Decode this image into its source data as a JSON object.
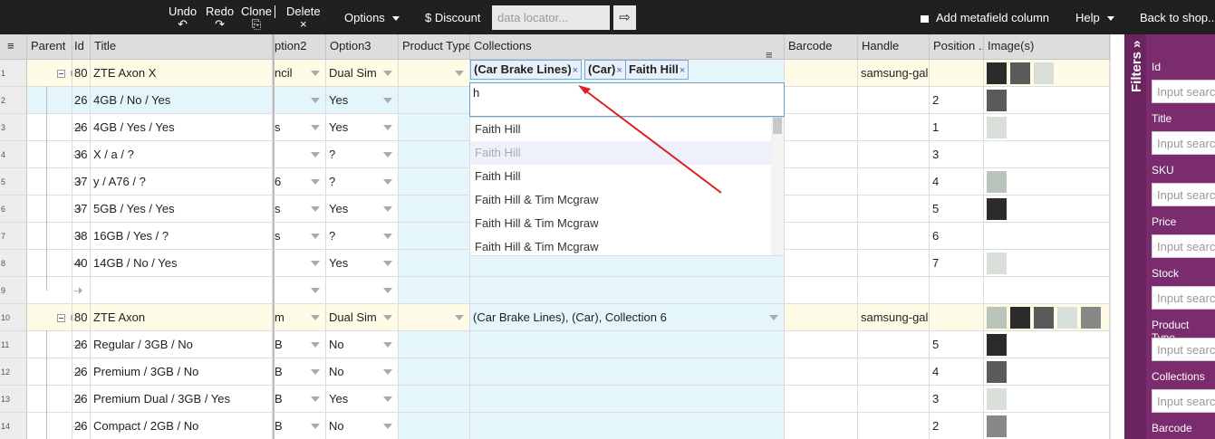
{
  "toolbar": {
    "undo": "Undo",
    "redo": "Redo",
    "clone": "Clone",
    "delete": "Delete",
    "options": "Options",
    "discount": "$ Discount",
    "locator_placeholder": "data locator...",
    "go_glyph": "⇨",
    "metafield": "Add metafield column",
    "help": "Help",
    "back": "Back to shop..."
  },
  "columns": [
    "Parent",
    "Id",
    "Title",
    "ption2",
    "Option3",
    "Product Type",
    "Collections",
    "Barcode",
    "Handle",
    "Position ...",
    "Image(s)"
  ],
  "column_menu_glyph": "≡",
  "rows": [
    {
      "n": "1",
      "id": "80",
      "title": "ZTE Axon X",
      "opt2": "ncil",
      "opt3": "Dual Sim",
      "collections": "",
      "handle": "samsung-gal",
      "position": "",
      "images": 3,
      "kind": "parent"
    },
    {
      "n": "2",
      "id": "26",
      "title": "4GB / No / Yes",
      "opt2": "",
      "opt3": "Yes",
      "collections": "",
      "handle": "",
      "position": "2",
      "images": 1,
      "kind": "child"
    },
    {
      "n": "3",
      "id": "26",
      "title": "4GB / Yes / Yes",
      "opt2": "s",
      "opt3": "Yes",
      "collections": "",
      "handle": "",
      "position": "1",
      "images": 1,
      "kind": "child"
    },
    {
      "n": "4",
      "id": "36",
      "title": "X / a / ?",
      "opt2": "",
      "opt3": "?",
      "collections": "",
      "handle": "",
      "position": "3",
      "images": 0,
      "kind": "child"
    },
    {
      "n": "5",
      "id": "37",
      "title": "y / A76 / ?",
      "opt2": "6",
      "opt3": "?",
      "collections": "",
      "handle": "",
      "position": "4",
      "images": 1,
      "kind": "child"
    },
    {
      "n": "6",
      "id": "37",
      "title": "5GB / Yes / Yes",
      "opt2": "s",
      "opt3": "Yes",
      "collections": "",
      "handle": "",
      "position": "5",
      "images": 1,
      "kind": "child"
    },
    {
      "n": "7",
      "id": "38",
      "title": "16GB / Yes / ?",
      "opt2": "s",
      "opt3": "?",
      "collections": "",
      "handle": "",
      "position": "6",
      "images": 0,
      "kind": "child"
    },
    {
      "n": "8",
      "id": "40",
      "title": "14GB / No / Yes",
      "opt2": "",
      "opt3": "Yes",
      "collections": "",
      "handle": "",
      "position": "7",
      "images": 1,
      "kind": "child"
    },
    {
      "n": "9",
      "id": "",
      "title": "",
      "opt2": "",
      "opt3": "",
      "collections": "",
      "handle": "",
      "position": "",
      "images": 0,
      "kind": "empty"
    },
    {
      "n": "10",
      "id": "80",
      "title": "ZTE Axon",
      "opt2": "m",
      "opt3": "Dual Sim",
      "collections": "(Car Brake Lines), (Car), Collection 6",
      "handle": "samsung-gal",
      "position": "",
      "images": 5,
      "kind": "parent"
    },
    {
      "n": "11",
      "id": "26",
      "title": "Regular / 3GB / No",
      "opt2": "B",
      "opt3": "No",
      "collections": "",
      "handle": "",
      "position": "5",
      "images": 1,
      "kind": "child"
    },
    {
      "n": "12",
      "id": "26",
      "title": "Premium / 3GB / No",
      "opt2": "B",
      "opt3": "No",
      "collections": "",
      "handle": "",
      "position": "4",
      "images": 1,
      "kind": "child"
    },
    {
      "n": "13",
      "id": "26",
      "title": "Premium Dual / 3GB / Yes",
      "opt2": "B",
      "opt3": "Yes",
      "collections": "",
      "handle": "",
      "position": "3",
      "images": 1,
      "kind": "child"
    },
    {
      "n": "14",
      "id": "26",
      "title": "Compact / 2GB / No",
      "opt2": "B",
      "opt3": "No",
      "collections": "",
      "handle": "",
      "position": "2",
      "images": 1,
      "kind": "child"
    }
  ],
  "editor": {
    "tags": [
      "(Car Brake Lines)",
      "(Car)",
      "Faith Hill"
    ],
    "tag_remove": "×",
    "input_value": "h",
    "suggestions": [
      "Faith Hill",
      "Faith Hill",
      "Faith Hill",
      "Faith Hill & Tim Mcgraw",
      "Faith Hill & Tim Mcgraw",
      "Faith Hill & Tim Mcgraw"
    ],
    "highlighted_index": 1
  },
  "filters": {
    "title": "Filters",
    "toggle_glyph": "»",
    "fields": [
      "Id",
      "Title",
      "SKU",
      "Price",
      "Stock",
      "Product Type",
      "Collections",
      "Barcode"
    ],
    "placeholder": "Input search"
  },
  "colors": {
    "toolbar_bg": "#202020",
    "filters_bg": "#7b2c6e",
    "parent_row": "#fefce6",
    "edit_col": "#e4f6fb",
    "annotation_arrow": "#e02020"
  }
}
